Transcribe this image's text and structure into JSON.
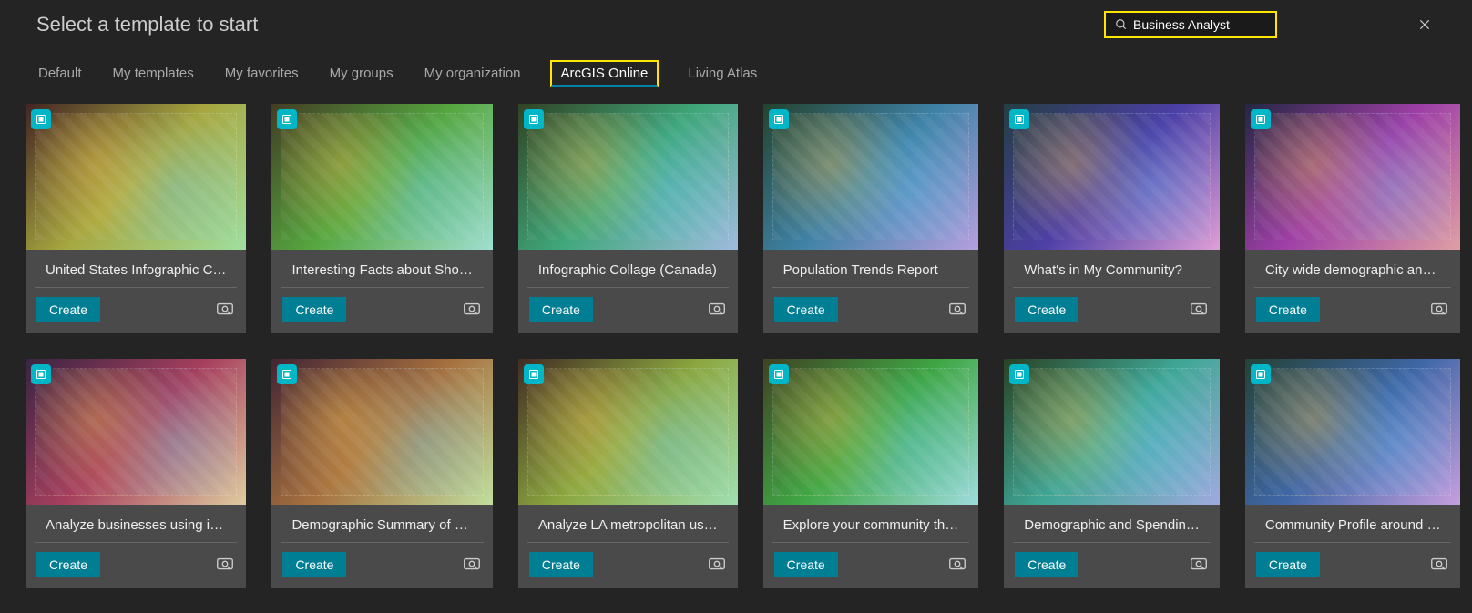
{
  "header": {
    "title": "Select a template to start",
    "search_value": "Business Analyst"
  },
  "tabs": [
    {
      "label": "Default",
      "active": false
    },
    {
      "label": "My templates",
      "active": false
    },
    {
      "label": "My favorites",
      "active": false
    },
    {
      "label": "My groups",
      "active": false
    },
    {
      "label": "My organization",
      "active": false
    },
    {
      "label": "ArcGIS Online",
      "active": true
    },
    {
      "label": "Living Atlas",
      "active": false
    }
  ],
  "create_label": "Create",
  "cards": [
    {
      "title": "United States Infographic C…"
    },
    {
      "title": "Interesting Facts about Sho…"
    },
    {
      "title": "Infographic Collage (Canada)"
    },
    {
      "title": "Population Trends Report"
    },
    {
      "title": "What's in My Community?"
    },
    {
      "title": "City wide demographic an…"
    },
    {
      "title": "Analyze businesses using i…"
    },
    {
      "title": "Demographic Summary of …"
    },
    {
      "title": "Analyze LA metropolitan us…"
    },
    {
      "title": "Explore your community th…"
    },
    {
      "title": "Demographic and Spendin…"
    },
    {
      "title": "Community Profile around …"
    }
  ]
}
